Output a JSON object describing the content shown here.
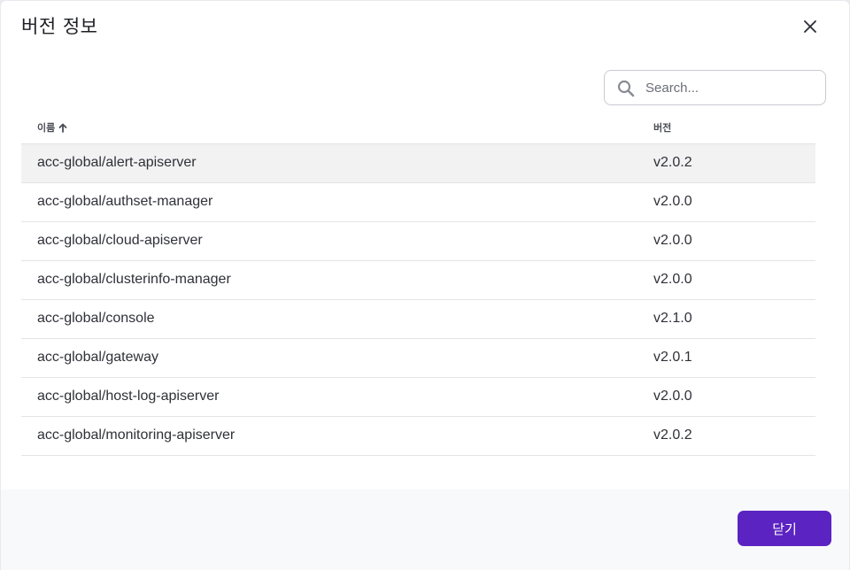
{
  "dialog": {
    "title": "버전 정보",
    "close_icon": "close-icon"
  },
  "search": {
    "placeholder": "Search...",
    "value": "",
    "icon": "search-icon"
  },
  "table": {
    "columns": [
      {
        "label": "이름",
        "sort": "ascending",
        "sort_icon": "arrow-up-icon"
      },
      {
        "label": "버전"
      }
    ],
    "rows": [
      {
        "name": "acc-global/alert-apiserver",
        "version": "v2.0.2",
        "hovered": true
      },
      {
        "name": "acc-global/authset-manager",
        "version": "v2.0.0"
      },
      {
        "name": "acc-global/cloud-apiserver",
        "version": "v2.0.0"
      },
      {
        "name": "acc-global/clusterinfo-manager",
        "version": "v2.0.0"
      },
      {
        "name": "acc-global/console",
        "version": "v2.1.0"
      },
      {
        "name": "acc-global/gateway",
        "version": "v2.0.1"
      },
      {
        "name": "acc-global/host-log-apiserver",
        "version": "v2.0.0"
      },
      {
        "name": "acc-global/monitoring-apiserver",
        "version": "v2.0.2"
      }
    ]
  },
  "footer": {
    "close_label": "닫기"
  },
  "colors": {
    "primary": "#5b23c2",
    "row_hover": "#f2f2f3",
    "footer_bg": "#f8f9fb"
  }
}
